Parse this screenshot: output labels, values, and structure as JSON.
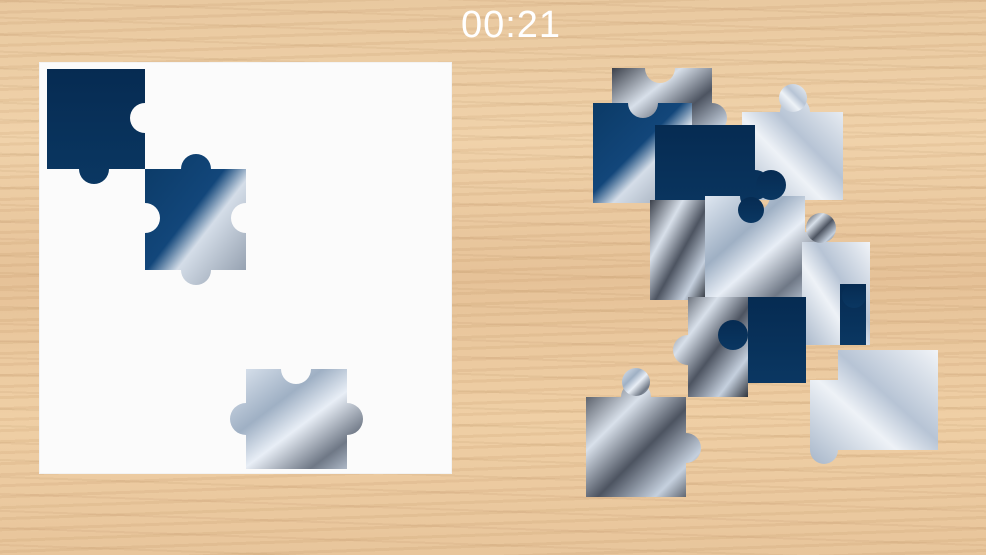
{
  "timer": {
    "value": "00:21"
  },
  "board": {
    "placed_pieces": 3
  },
  "tray": {
    "loose_pieces": 16
  },
  "colors": {
    "table_wood": "#ebc79d",
    "board": "#fbfbfb",
    "sky_dark": "#08325a",
    "snow": "#c9d6e6",
    "rock": "#5a6270",
    "timer_text": "#ffffff"
  }
}
